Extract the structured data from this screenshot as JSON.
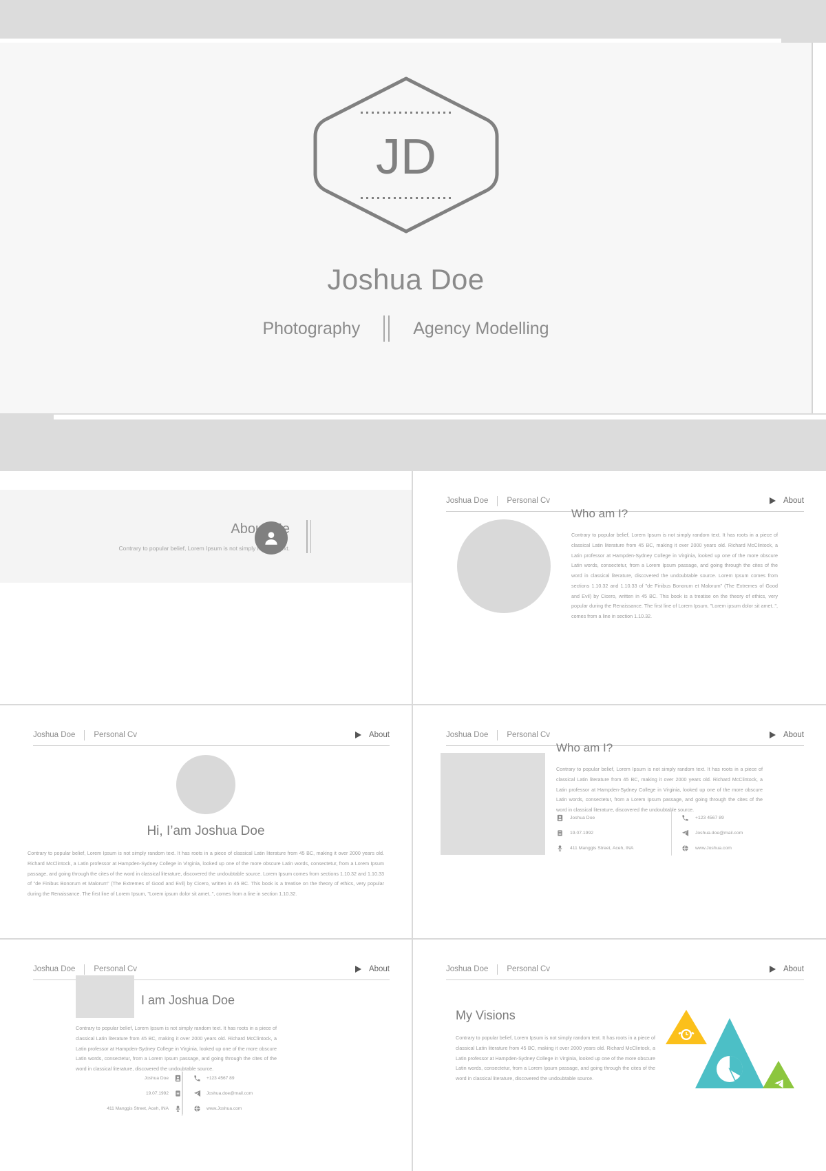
{
  "cover": {
    "monogram": "JD",
    "name": "Joshua Doe",
    "role_left": "Photography",
    "role_right": "Agency Modelling",
    "separator_icon": "double-pipe-divider"
  },
  "slide_header": {
    "name": "Joshua Doe",
    "category": "Personal  Cv",
    "action_label": "About",
    "action_icon": "play-triangle-icon"
  },
  "lorem": {
    "short": "Contrary to popular belief, Lorem Ipsum is not simply random text.",
    "medium": "Contrary to popular belief, Lorem Ipsum is not simply random text. It has roots in a piece of classical Latin literature from 45 BC, making it over 2000 years old. Richard McClintock, a Latin professor at Hampden-Sydney College in Virginia, looked up one of the more obscure Latin words, consectetur, from a Lorem Ipsum passage, and going through the cites of the word in classical literature, discovered the undoubtable source.",
    "long": "Contrary to popular belief, Lorem Ipsum is not simply random text. It has roots in a piece of classical Latin literature from 45 BC, making it over 2000 years old. Richard McClintock, a Latin professor at Hampden-Sydney College in Virginia, looked up one of the more obscure Latin words, consectetur, from a Lorem Ipsum passage, and going through the cites of the word in classical literature, discovered the undoubtable source. Lorem Ipsum comes from sections 1.10.32 and 1.10.33 of \"de Finibus Bonorum et Malorum\" (The Extremes of Good and Evil) by Cicero, written in 45 BC. This book is a treatise on the theory of ethics, very popular during the Renaissance. The first line of Lorem Ipsum, \"Lorem ipsum dolor sit amet..\", comes from a line in section 1.10.32."
  },
  "slides": {
    "about_me": {
      "title": "About Me",
      "subtitle": "Contrary to popular belief, Lorem Ipsum is not simply random text.",
      "avatar_icon": "user-avatar-icon"
    },
    "who_am_i_circle": {
      "title": "Who am I?",
      "image_placeholder": "circle-photo-placeholder"
    },
    "hi_i_am": {
      "title": "Hi, I’am Joshua Doe",
      "image_placeholder": "circle-photo-placeholder"
    },
    "who_am_i_square": {
      "title": "Who am I?",
      "image_placeholder": "square-photo-placeholder"
    },
    "i_am": {
      "title": "I am Joshua Doe",
      "image_placeholder": "square-photo-placeholder"
    },
    "my_visions": {
      "title": "My Visions",
      "art": {
        "alarm_triangle_color": "#FBC01B",
        "alarm_icon": "alarm-clock-icon",
        "pie_triangle_color": "#4CBFC6",
        "pie_icon": "pie-chart-icon",
        "send_triangle_color": "#8CC63E",
        "send_icon": "paper-plane-icon"
      }
    }
  },
  "contact": {
    "name": {
      "icon": "contact-card-icon",
      "value": "Joshua Doe"
    },
    "birthday": {
      "icon": "calendar-icon",
      "value": "19.07.1992"
    },
    "address": {
      "icon": "map-pin-icon",
      "value": "411 Manggis Street, Aceh, INA"
    },
    "phone": {
      "icon": "phone-icon",
      "value": "+123 4567 89"
    },
    "email": {
      "icon": "paper-plane-icon",
      "value": "Joshua.doe@mail.com"
    },
    "website": {
      "icon": "globe-icon",
      "value": "www.Joshua.com"
    }
  },
  "colors": {
    "text_gray": "#8b8b8b",
    "body_gray": "#9b9b9b",
    "band_gray": "#dcdcdc",
    "placeholder_gray": "#d9d9d9",
    "yellow": "#FBC01B",
    "teal": "#4CBFC6",
    "green": "#8CC63E"
  }
}
